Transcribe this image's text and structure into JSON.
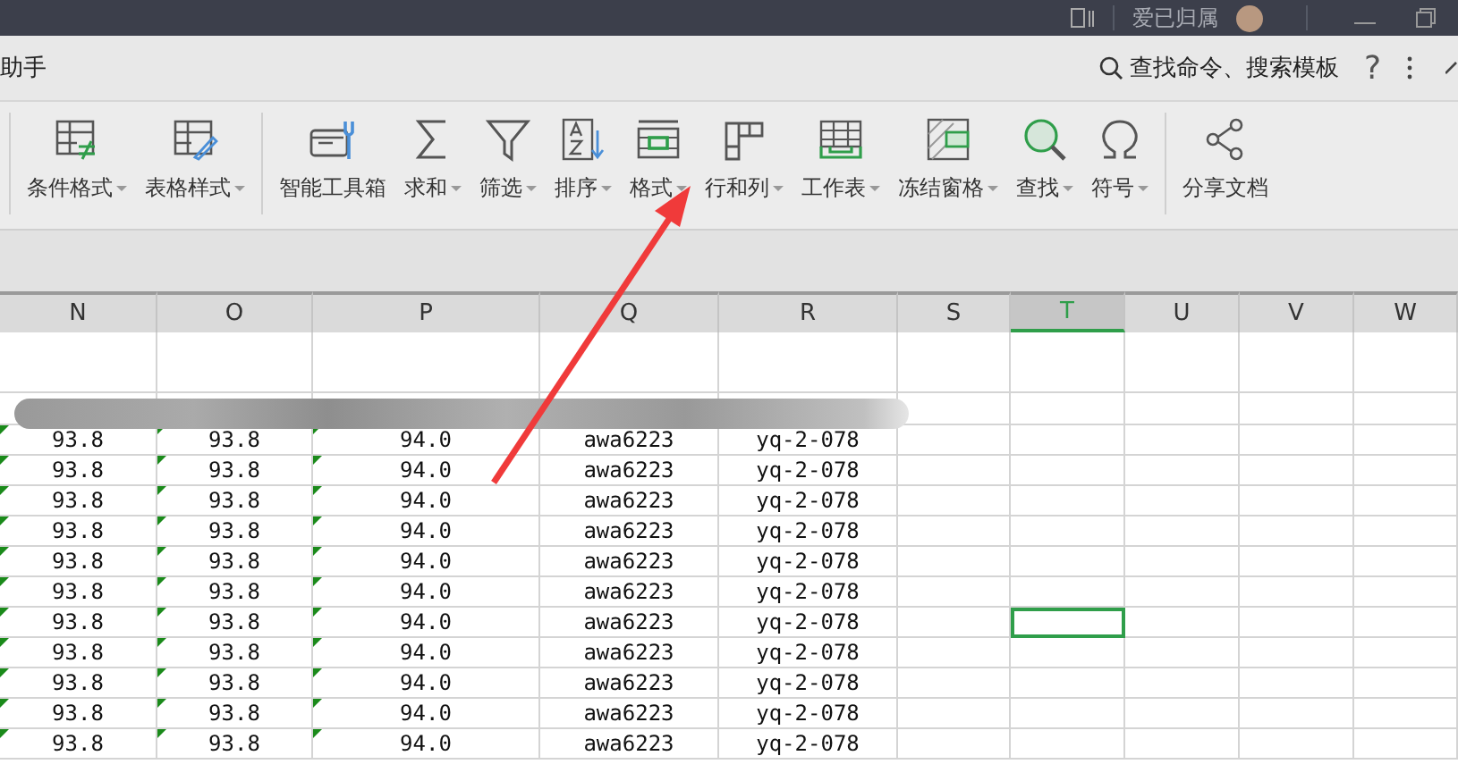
{
  "title_bar": {
    "user_name": "爱已归属"
  },
  "menu_bar": {
    "left_text": "助手",
    "search_label": "查找命令、搜索模板",
    "help_label": "?"
  },
  "ribbon": {
    "groups": [
      {
        "items": [
          {
            "label": "条件格式",
            "kind": "conditional-format",
            "dropdown": true
          },
          {
            "label": "表格样式",
            "kind": "table-style",
            "dropdown": true
          }
        ]
      },
      {
        "items": [
          {
            "label": "智能工具箱",
            "kind": "toolbox",
            "dropdown": false
          },
          {
            "label": "求和",
            "kind": "sum",
            "dropdown": true
          },
          {
            "label": "筛选",
            "kind": "filter",
            "dropdown": true
          },
          {
            "label": "排序",
            "kind": "sort",
            "dropdown": true
          },
          {
            "label": "格式",
            "kind": "format",
            "dropdown": true
          },
          {
            "label": "行和列",
            "kind": "rows-cols",
            "dropdown": true
          },
          {
            "label": "工作表",
            "kind": "worksheet",
            "dropdown": true
          },
          {
            "label": "冻结窗格",
            "kind": "freeze",
            "dropdown": true
          },
          {
            "label": "查找",
            "kind": "find",
            "dropdown": true
          },
          {
            "label": "符号",
            "kind": "symbol",
            "dropdown": true
          }
        ]
      },
      {
        "items": [
          {
            "label": "分享文档",
            "kind": "share",
            "dropdown": false
          }
        ]
      }
    ]
  },
  "sheet": {
    "columns": [
      {
        "label": "N",
        "selected": false,
        "cell_marker": true
      },
      {
        "label": "O",
        "selected": false,
        "cell_marker": true
      },
      {
        "label": "P",
        "selected": false,
        "cell_marker": true
      },
      {
        "label": "Q",
        "selected": false,
        "cell_marker": false
      },
      {
        "label": "R",
        "selected": false,
        "cell_marker": false
      },
      {
        "label": "S",
        "selected": false,
        "cell_marker": false
      },
      {
        "label": "T",
        "selected": true,
        "cell_marker": false
      },
      {
        "label": "U",
        "selected": false,
        "cell_marker": false
      },
      {
        "label": "V",
        "selected": false,
        "cell_marker": false
      },
      {
        "label": "W",
        "selected": false,
        "cell_marker": false
      }
    ],
    "rows": [
      {
        "cells": [
          "93.8",
          "93.8",
          "94.0",
          "awa6223",
          "yq-2-078"
        ],
        "selected": false
      },
      {
        "cells": [
          "93.8",
          "93.8",
          "94.0",
          "awa6223",
          "yq-2-078"
        ],
        "selected": false
      },
      {
        "cells": [
          "93.8",
          "93.8",
          "94.0",
          "awa6223",
          "yq-2-078"
        ],
        "selected": false
      },
      {
        "cells": [
          "93.8",
          "93.8",
          "94.0",
          "awa6223",
          "yq-2-078"
        ],
        "selected": false
      },
      {
        "cells": [
          "93.8",
          "93.8",
          "94.0",
          "awa6223",
          "yq-2-078"
        ],
        "selected": false
      },
      {
        "cells": [
          "93.8",
          "93.8",
          "94.0",
          "awa6223",
          "yq-2-078"
        ],
        "selected": false
      },
      {
        "cells": [
          "93.8",
          "93.8",
          "94.0",
          "awa6223",
          "yq-2-078"
        ],
        "selected": true
      },
      {
        "cells": [
          "93.8",
          "93.8",
          "94.0",
          "awa6223",
          "yq-2-078"
        ],
        "selected": false
      },
      {
        "cells": [
          "93.8",
          "93.8",
          "94.0",
          "awa6223",
          "yq-2-078"
        ],
        "selected": false
      },
      {
        "cells": [
          "93.8",
          "93.8",
          "94.0",
          "awa6223",
          "yq-2-078"
        ],
        "selected": false
      },
      {
        "cells": [
          "93.8",
          "93.8",
          "94.0",
          "awa6223",
          "yq-2-078"
        ],
        "selected": false
      }
    ]
  }
}
